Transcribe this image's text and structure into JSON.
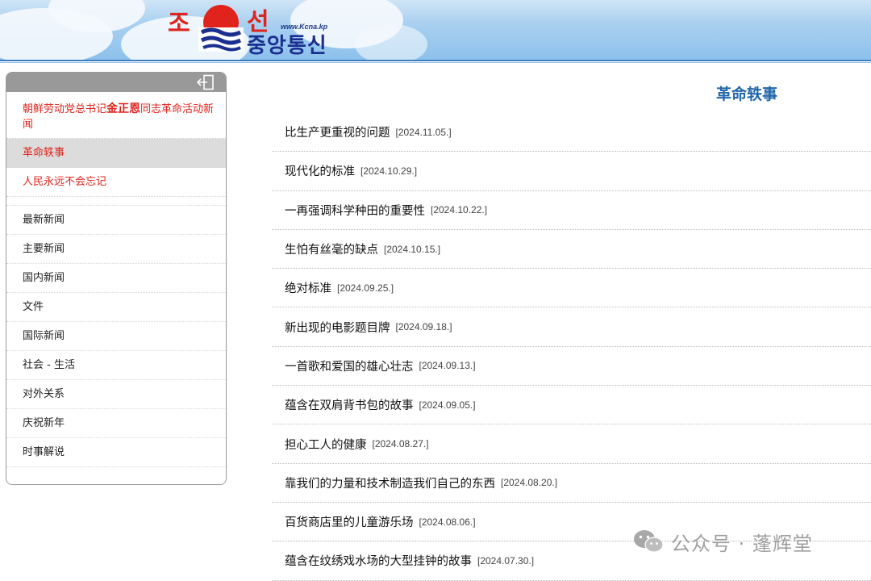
{
  "header": {
    "logo_left": "조",
    "logo_right": "선",
    "logo_url": "www.Kcna.kp",
    "logo_kcna": "중앙통신"
  },
  "sidebar": {
    "featured": {
      "prefix": "朝鲜劳动党总书记",
      "name": "金正恩",
      "suffix": "同志革命活动新闻"
    },
    "items_top": [
      {
        "label": "革命轶事",
        "active": true
      },
      {
        "label": "人民永远不会忘记",
        "active": false
      }
    ],
    "items": [
      {
        "label": "最新新闻"
      },
      {
        "label": "主要新闻"
      },
      {
        "label": "国内新闻"
      },
      {
        "label": "文件"
      },
      {
        "label": "国际新闻"
      },
      {
        "label": "社会 - 生活"
      },
      {
        "label": "对外关系"
      },
      {
        "label": "庆祝新年"
      },
      {
        "label": "时事解说"
      }
    ]
  },
  "main": {
    "title": "革命轶事",
    "articles": [
      {
        "title": "比生产更重视的问题",
        "date": "[2024.11.05.]"
      },
      {
        "title": "现代化的标准",
        "date": "[2024.10.29.]"
      },
      {
        "title": "一再强调科学种田的重要性",
        "date": "[2024.10.22.]"
      },
      {
        "title": "生怕有丝毫的缺点",
        "date": "[2024.10.15.]"
      },
      {
        "title": "绝对标准",
        "date": "[2024.09.25.]"
      },
      {
        "title": "新出现的电影题目牌",
        "date": "[2024.09.18.]"
      },
      {
        "title": "一首歌和爱国的雄心壮志",
        "date": "[2024.09.13.]"
      },
      {
        "title": "蕴含在双肩背书包的故事",
        "date": "[2024.09.05.]"
      },
      {
        "title": "担心工人的健康",
        "date": "[2024.08.27.]"
      },
      {
        "title": "靠我们的力量和技术制造我们自己的东西",
        "date": "[2024.08.20.]"
      },
      {
        "title": "百货商店里的儿童游乐场",
        "date": "[2024.08.06.]"
      },
      {
        "title": "蕴含在纹绣戏水场的大型挂钟的故事",
        "date": "[2024.07.30.]"
      }
    ]
  },
  "watermark": {
    "text": "公众号 · 蓬辉堂",
    "icon": "wechat-icon"
  },
  "colors": {
    "accent_red": "#e0231c",
    "title_blue": "#2266aa",
    "sidebar_bar": "#999999",
    "active_bg": "#dcdcdc"
  }
}
